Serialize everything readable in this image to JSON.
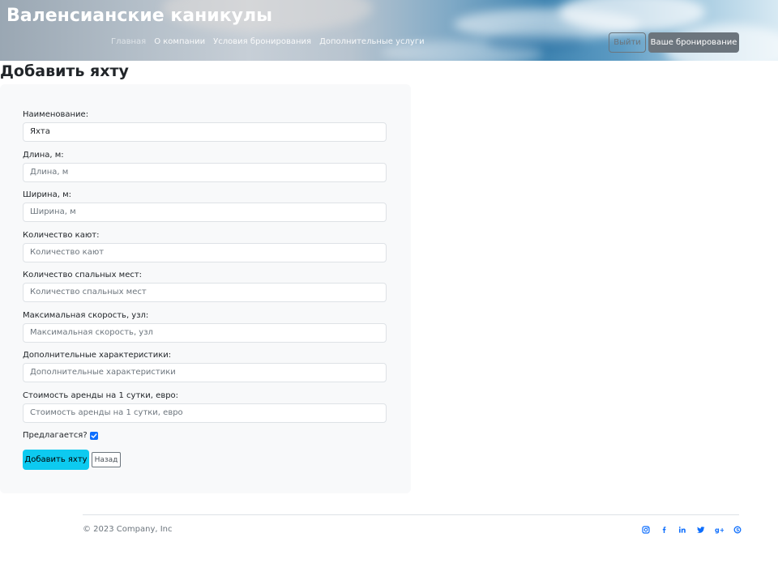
{
  "header": {
    "site_title": "Валенсианские каникулы",
    "nav": [
      "Главная",
      "О компании",
      "Условия бронирования",
      "Дополнительные услуги"
    ],
    "logout_label": "Выйти",
    "booking_label": "Ваше бронирование"
  },
  "page": {
    "title": "Добавить яхту"
  },
  "form": {
    "fields": [
      {
        "label": "Наименование:",
        "value": "Яхта",
        "placeholder": ""
      },
      {
        "label": "Длина, м:",
        "value": "",
        "placeholder": "Длина, м"
      },
      {
        "label": "Ширина, м:",
        "value": "",
        "placeholder": "Ширина, м"
      },
      {
        "label": "Количество кают:",
        "value": "",
        "placeholder": "Количество кают"
      },
      {
        "label": "Количество спальных мест:",
        "value": "",
        "placeholder": "Количество спальных мест"
      },
      {
        "label": "Максимальная скорость, узл:",
        "value": "",
        "placeholder": "Максимальная скорость, узл"
      },
      {
        "label": "Дополнительные характеристики:",
        "value": "",
        "placeholder": "Дополнительные характеристики"
      },
      {
        "label": "Стоимость аренды на 1 сутки, евро:",
        "value": "",
        "placeholder": "Стоимость аренды на 1 сутки, евро"
      }
    ],
    "offered_label": "Предлагается?",
    "offered_checked": true,
    "submit_label": "Добавить яхту",
    "back_label": "Назад"
  },
  "footer": {
    "copyright": "© 2023 Company, Inc",
    "social_icons": [
      "instagram-icon",
      "facebook-icon",
      "linkedin-icon",
      "twitter-icon",
      "google-plus-icon",
      "skype-icon"
    ]
  },
  "colors": {
    "primary": "#0d6efd",
    "info": "#0dcaf0",
    "secondary": "#6c757d",
    "card_bg": "#f8f9fa"
  }
}
